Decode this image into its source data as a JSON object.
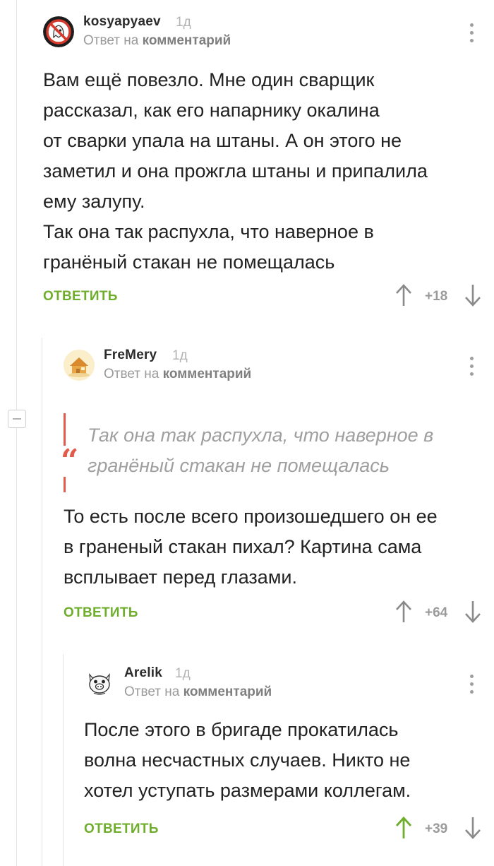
{
  "comments": [
    {
      "username": "kosyapyaev",
      "time": "1д",
      "reply_prefix": "Ответ на",
      "reply_target": "комментарий",
      "text_lines": [
        "Вам ещё повезло. Мне один сварщик",
        "рассказал, как его напарнику окалина",
        "от сварки упала на штаны. А он этого не",
        "заметил и она прожгла штаны и припалила",
        "ему залупу.",
        "Так она так распухла, что наверное в",
        "гранёный стакан не помещалась"
      ],
      "reply_label": "ОТВЕТИТЬ",
      "rating": "+18",
      "upvoted": false
    },
    {
      "username": "FreMery",
      "time": "1д",
      "reply_prefix": "Ответ на",
      "reply_target": "комментарий",
      "quote_mark": "“",
      "quote_lines": [
        "Так она так распухла, что наверное в",
        "гранёный стакан не помещалась"
      ],
      "text_lines": [
        "То есть после всего произошедшего он ее",
        "в граненый стакан пихал? Картина сама",
        "всплывает перед глазами."
      ],
      "reply_label": "ОТВЕТИТЬ",
      "rating": "+64",
      "upvoted": false
    },
    {
      "username": "Arelik",
      "time": "1д",
      "reply_prefix": "Ответ на",
      "reply_target": "комментарий",
      "text_lines": [
        "После этого в бригаде прокатилась",
        "волна несчастных случаев. Никто не",
        "хотел уступать размерами коллегам."
      ],
      "reply_label": "ОТВЕТИТЬ",
      "rating": "+39",
      "upvoted": true
    }
  ],
  "colors": {
    "reply_green": "#6fae2d",
    "quote_red": "#e15a4a",
    "upvote_active": "#6fae2d",
    "vote_inactive": "#8a8a8a"
  },
  "icons": {
    "avatar_1": "ghost-no-sign-avatar",
    "avatar_2": "house-avatar",
    "avatar_3": "cartoon-pig-avatar",
    "more": "vertical-dots-icon",
    "up": "arrow-up-icon",
    "down": "arrow-down-icon",
    "collapse": "minus-box-icon"
  }
}
